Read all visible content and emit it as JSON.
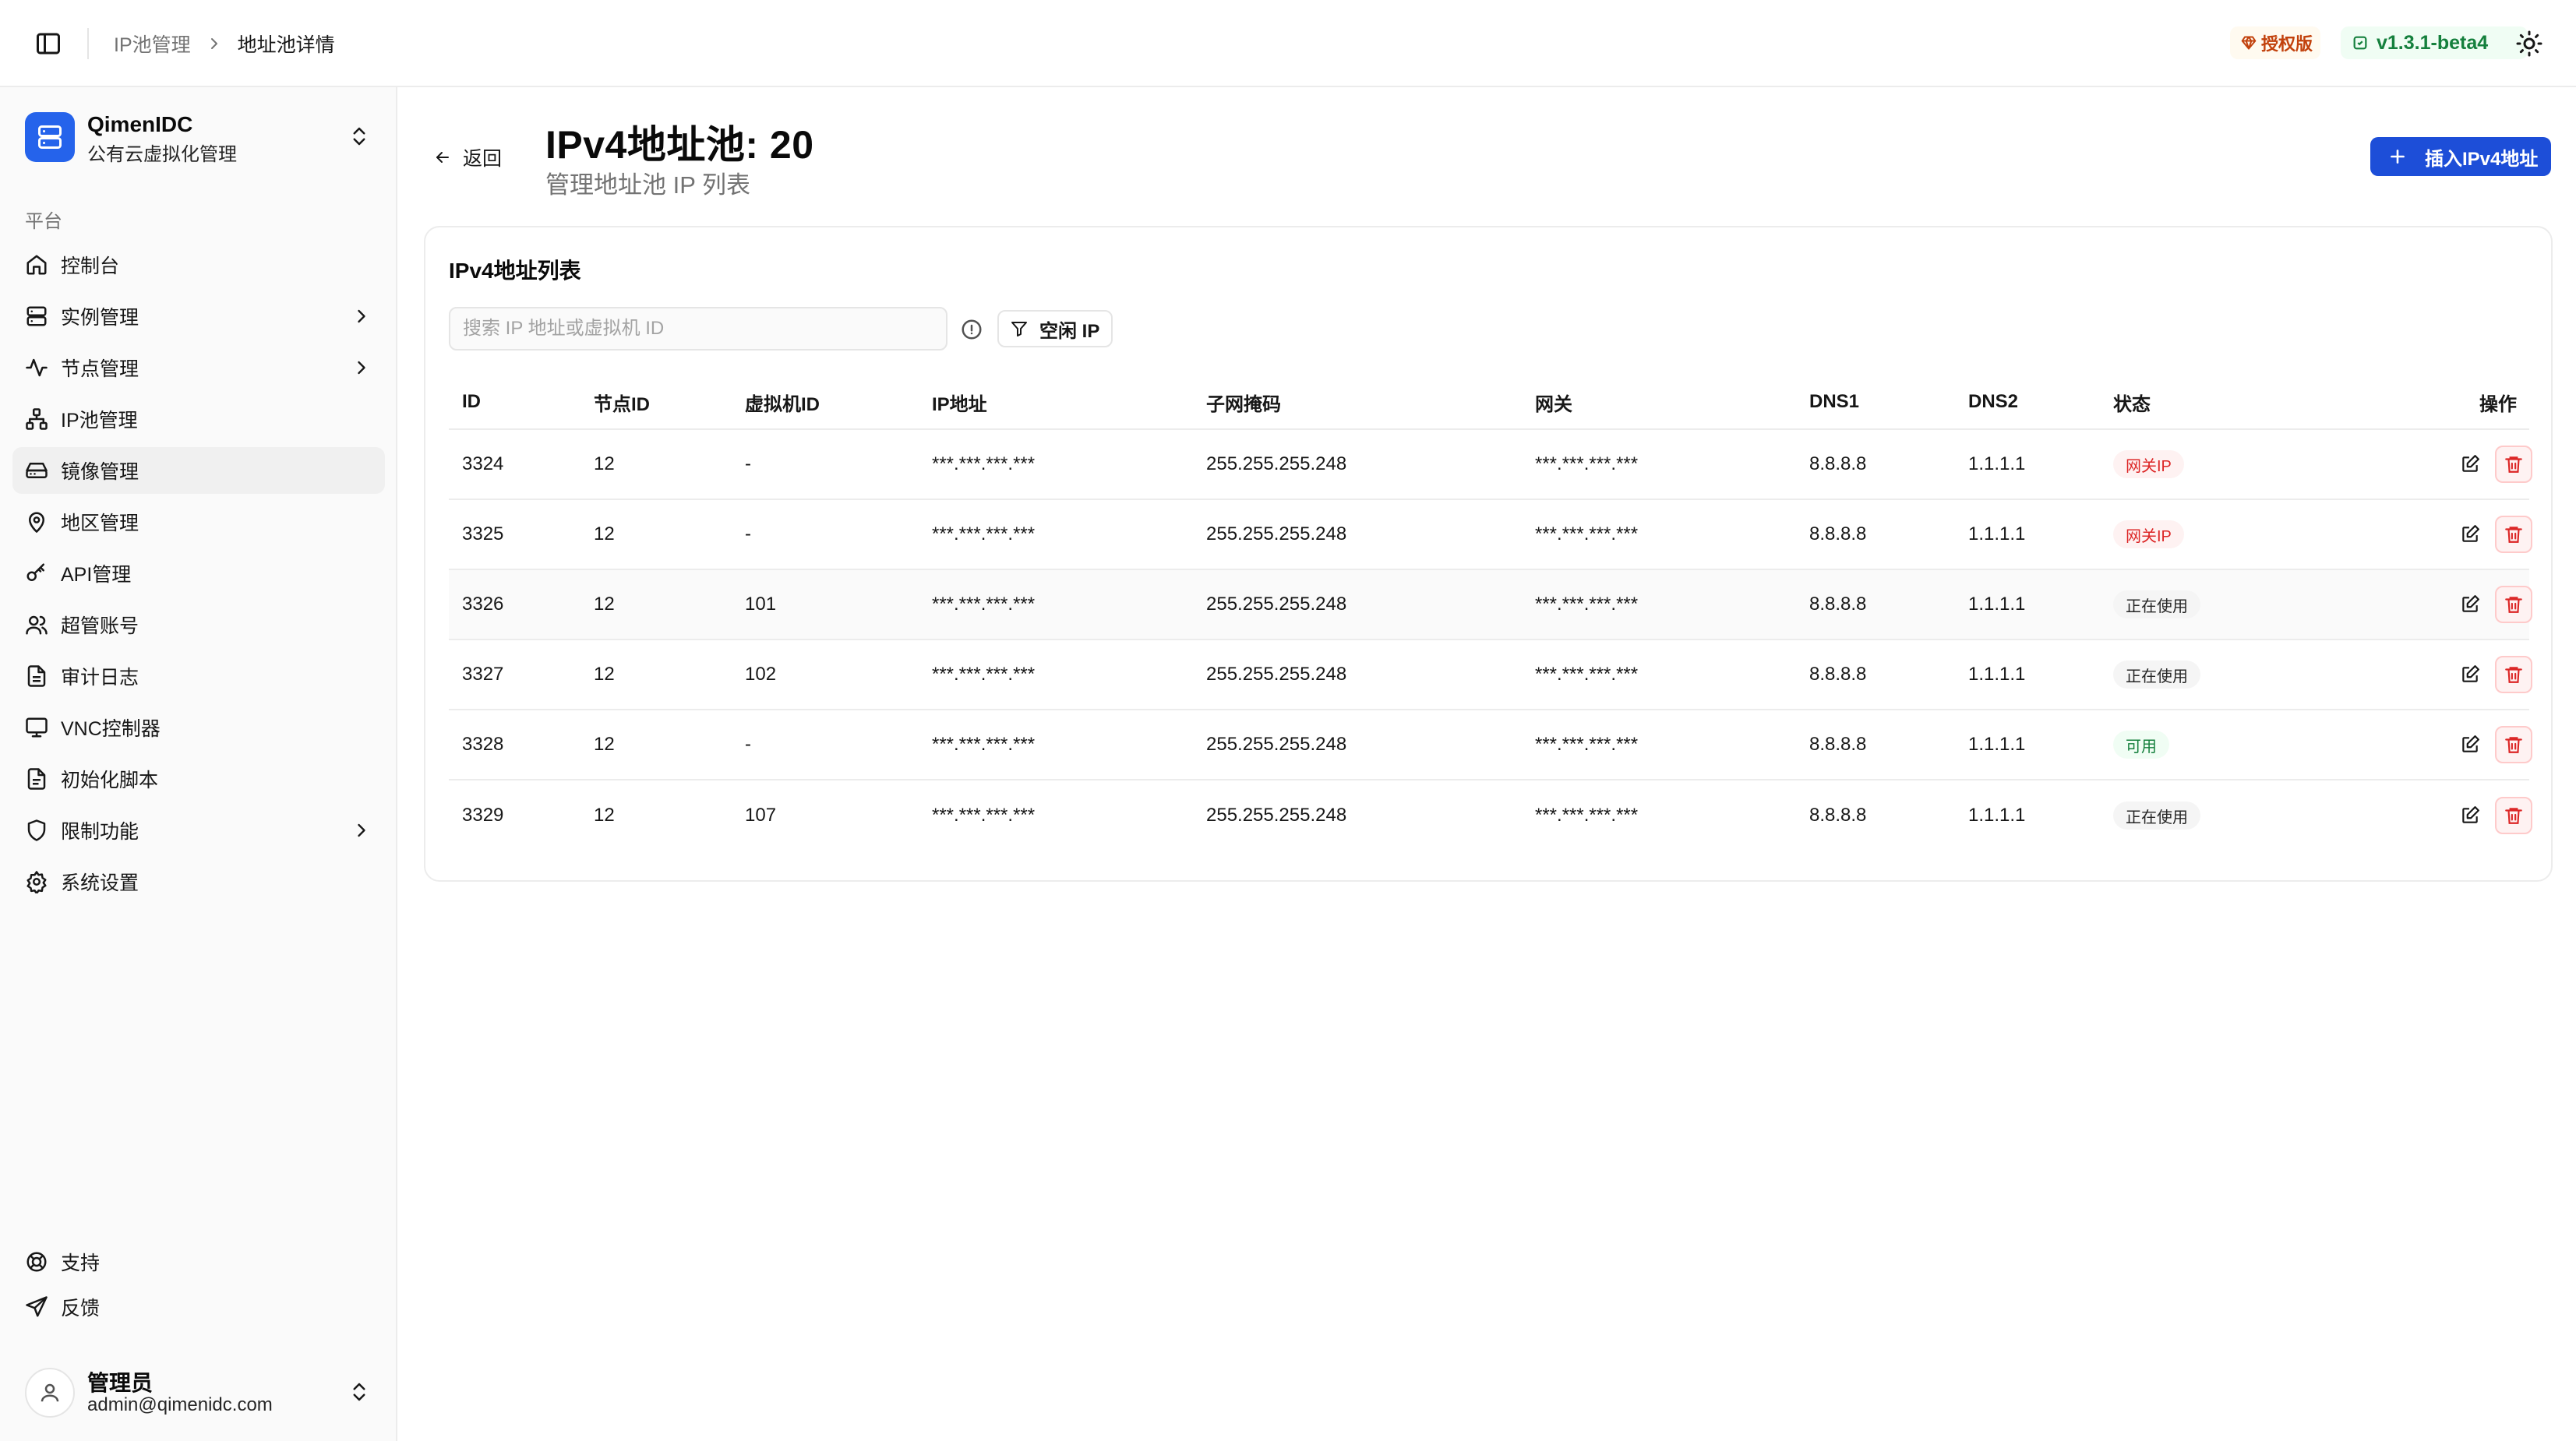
{
  "header": {
    "breadcrumb": [
      "IP池管理",
      "地址池详情"
    ],
    "license_label": "授权版",
    "version": "v1.3.1-beta4"
  },
  "sidebar": {
    "org_name": "QimenIDC",
    "org_subtitle": "公有云虚拟化管理",
    "group_label": "平台",
    "items": [
      {
        "label": "控制台",
        "icon": "home-icon",
        "has_children": false
      },
      {
        "label": "实例管理",
        "icon": "server-icon",
        "has_children": true
      },
      {
        "label": "节点管理",
        "icon": "activity-icon",
        "has_children": true
      },
      {
        "label": "IP池管理",
        "icon": "network-icon",
        "has_children": false
      },
      {
        "label": "镜像管理",
        "icon": "hard-drive-icon",
        "has_children": false,
        "active": true
      },
      {
        "label": "地区管理",
        "icon": "map-pin-icon",
        "has_children": false
      },
      {
        "label": "API管理",
        "icon": "key-icon",
        "has_children": false
      },
      {
        "label": "超管账号",
        "icon": "users-icon",
        "has_children": false
      },
      {
        "label": "审计日志",
        "icon": "file-text-icon",
        "has_children": false
      },
      {
        "label": "VNC控制器",
        "icon": "monitor-icon",
        "has_children": false
      },
      {
        "label": "初始化脚本",
        "icon": "file-code-icon",
        "has_children": false
      },
      {
        "label": "限制功能",
        "icon": "shield-icon",
        "has_children": true
      },
      {
        "label": "系统设置",
        "icon": "settings-icon",
        "has_children": false
      }
    ],
    "bottom_items": [
      {
        "label": "支持",
        "icon": "life-buoy-icon"
      },
      {
        "label": "反馈",
        "icon": "send-icon"
      }
    ],
    "user": {
      "name": "管理员",
      "email": "admin@qimenidc.com"
    }
  },
  "main": {
    "back_label": "返回",
    "title": "IPv4地址池: 20",
    "subtitle": "管理地址池 IP 列表",
    "insert_button": "插入IPv4地址",
    "card_title": "IPv4地址列表",
    "search_placeholder": "搜索 IP 地址或虚拟机 ID",
    "filter_label": "空闲 IP",
    "table": {
      "headers": [
        "ID",
        "节点ID",
        "虚拟机ID",
        "IP地址",
        "子网掩码",
        "网关",
        "DNS1",
        "DNS2",
        "状态",
        "操作"
      ],
      "rows": [
        {
          "id": "3324",
          "node": "12",
          "vm": "-",
          "ip": "***.***.***.***",
          "mask": "255.255.255.248",
          "gateway": "***.***.***.***",
          "dns1": "8.8.8.8",
          "dns2": "1.1.1.1",
          "status": "网关IP",
          "status_type": "gateway"
        },
        {
          "id": "3325",
          "node": "12",
          "vm": "-",
          "ip": "***.***.***.***",
          "mask": "255.255.255.248",
          "gateway": "***.***.***.***",
          "dns1": "8.8.8.8",
          "dns2": "1.1.1.1",
          "status": "网关IP",
          "status_type": "gateway"
        },
        {
          "id": "3326",
          "node": "12",
          "vm": "101",
          "ip": "***.***.***.***",
          "mask": "255.255.255.248",
          "gateway": "***.***.***.***",
          "dns1": "8.8.8.8",
          "dns2": "1.1.1.1",
          "status": "正在使用",
          "status_type": "inuse"
        },
        {
          "id": "3327",
          "node": "12",
          "vm": "102",
          "ip": "***.***.***.***",
          "mask": "255.255.255.248",
          "gateway": "***.***.***.***",
          "dns1": "8.8.8.8",
          "dns2": "1.1.1.1",
          "status": "正在使用",
          "status_type": "inuse"
        },
        {
          "id": "3328",
          "node": "12",
          "vm": "-",
          "ip": "***.***.***.***",
          "mask": "255.255.255.248",
          "gateway": "***.***.***.***",
          "dns1": "8.8.8.8",
          "dns2": "1.1.1.1",
          "status": "可用",
          "status_type": "free"
        },
        {
          "id": "3329",
          "node": "12",
          "vm": "107",
          "ip": "***.***.***.***",
          "mask": "255.255.255.248",
          "gateway": "***.***.***.***",
          "dns1": "8.8.8.8",
          "dns2": "1.1.1.1",
          "status": "正在使用",
          "status_type": "inuse"
        }
      ]
    }
  },
  "colors": {
    "primary": "#1d4ed8",
    "logo_bg": "#2563eb",
    "danger": "#dc2626",
    "success": "#15803d",
    "license": "#c2410c"
  }
}
